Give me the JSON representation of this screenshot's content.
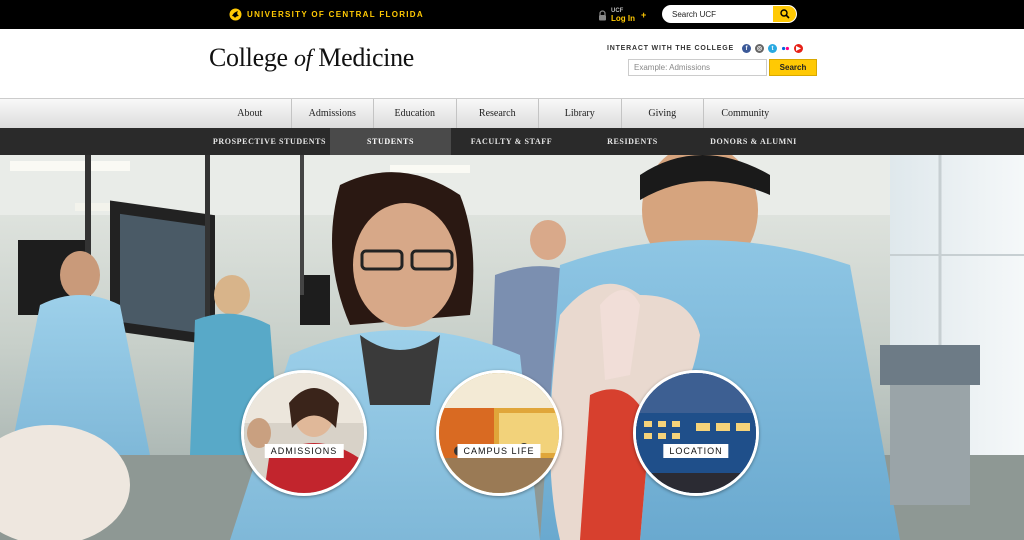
{
  "ucf_bar": {
    "university_name": "UNIVERSITY OF CENTRAL FLORIDA",
    "login_small": "UCF",
    "login_label": "Log In",
    "login_plus": "+",
    "search_placeholder": "Search UCF"
  },
  "header": {
    "title_part1": "College ",
    "title_part2": "of",
    "title_part3": " Medicine",
    "interact_label": "INTERACT WITH THE COLLEGE",
    "social_icons": [
      "facebook-icon",
      "instagram-icon",
      "twitter-icon",
      "flickr-icon",
      "youtube-icon"
    ],
    "search_placeholder": "Example: Admissions",
    "search_button": "Search"
  },
  "main_nav": {
    "items": [
      "About",
      "Admissions",
      "Education",
      "Research",
      "Library",
      "Giving",
      "Community"
    ]
  },
  "sub_nav": {
    "items": [
      "PROSPECTIVE STUDENTS",
      "STUDENTS",
      "FACULTY & STAFF",
      "RESIDENTS",
      "DONORS & ALUMNI"
    ],
    "active": "STUDENTS"
  },
  "hero": {
    "circles": [
      {
        "label": "ADMISSIONS"
      },
      {
        "label": "CAMPUS LIFE"
      },
      {
        "label": "LOCATION"
      }
    ]
  },
  "colors": {
    "ucf_gold": "#ffc904",
    "bar_black": "#000000",
    "subnav_dark": "#2a2a2a",
    "subnav_active": "#4a4a4a"
  }
}
